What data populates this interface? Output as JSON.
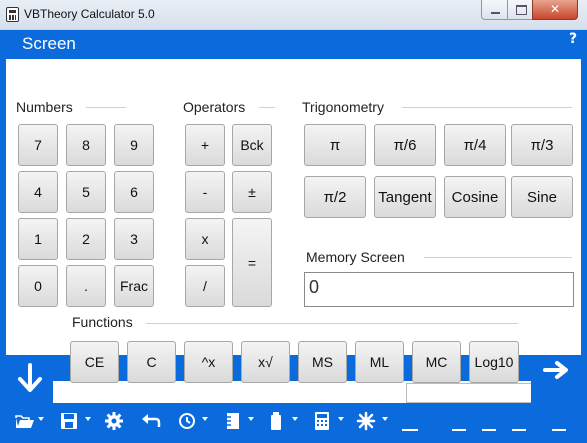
{
  "window": {
    "title": "VBTheory Calculator 5.0"
  },
  "screen": {
    "title": "Screen",
    "help": "?",
    "field1": "",
    "field2": "",
    "field3": "="
  },
  "groups": {
    "numbers": "Numbers",
    "operators": "Operators",
    "trigonometry": "Trigonometry",
    "memory_screen": "Memory Screen",
    "functions": "Functions"
  },
  "numbers": {
    "k7": "7",
    "k8": "8",
    "k9": "9",
    "k4": "4",
    "k5": "5",
    "k6": "6",
    "k1": "1",
    "k2": "2",
    "k3": "3",
    "k0": "0",
    "dot": ".",
    "frac": "Frac"
  },
  "operators": {
    "plus": "+",
    "back": "Bck",
    "minus": "-",
    "plusminus": "±",
    "times": "x",
    "divide": "/",
    "equals": "="
  },
  "trig": {
    "pi": "π",
    "pi6": "π/6",
    "pi4": "π/4",
    "pi3": "π/3",
    "pi2": "π/2",
    "tangent": "Tangent",
    "cosine": "Cosine",
    "sine": "Sine"
  },
  "memory": {
    "value": "0"
  },
  "functions": {
    "ce": "CE",
    "c": "C",
    "pow": "^x",
    "root": "x√",
    "ms": "MS",
    "ml": "ML",
    "mc": "MC",
    "log10": "Log10"
  },
  "colors": {
    "accent": "#0b6bdc",
    "panel": "#ffffff",
    "button": "#e6e6e6"
  },
  "icons": [
    "open-folder-icon",
    "save-icon",
    "settings-gear-icon",
    "undo-icon",
    "history-icon",
    "notes-icon",
    "battery-icon",
    "calculator-icon",
    "burst-icon",
    "minimize-dash-icon"
  ]
}
